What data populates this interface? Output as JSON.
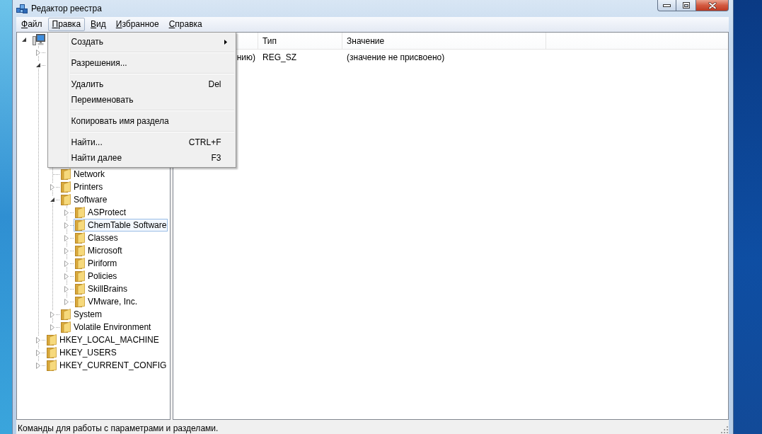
{
  "window": {
    "title": "Редактор реестра",
    "caption_buttons": [
      {
        "kind": "minimize"
      },
      {
        "kind": "maximize"
      },
      {
        "kind": "close"
      }
    ]
  },
  "menu_bar": {
    "items": [
      {
        "label": "Файл",
        "selected": false
      },
      {
        "label": "Правка",
        "selected": true
      },
      {
        "label": "Вид",
        "selected": false
      },
      {
        "label": "Избранное",
        "selected": false
      },
      {
        "label": "Справка",
        "selected": false
      }
    ]
  },
  "dropdown_menu": {
    "groups": [
      [
        {
          "label": "Создать",
          "submenu": true
        }
      ],
      [
        {
          "label": "Разрешения...",
          "submenu": false
        }
      ],
      [
        {
          "label": "Удалить",
          "shortcut": "Del",
          "submenu": false
        },
        {
          "label": "Переименовать",
          "submenu": false
        }
      ],
      [
        {
          "label": "Копировать имя раздела",
          "submenu": false
        }
      ],
      [
        {
          "label": "Найти...",
          "shortcut": "CTRL+F",
          "submenu": false
        },
        {
          "label": "Найти далее",
          "shortcut": "F3",
          "submenu": false
        }
      ]
    ]
  },
  "tree": {
    "items": [
      {
        "expanded": true,
        "selected": false,
        "children": [
          {
            "expanded": false
          },
          {
            "expanded": true,
            "children": [
              {
                "label": "Network",
                "selected": false
              },
              {
                "label": "Printers",
                "expanded": false,
                "selected": false
              },
              {
                "label": "Software",
                "expanded": true,
                "selected": false,
                "children": [
                  {
                    "label": "ASProtect",
                    "expanded": false,
                    "selected": false
                  },
                  {
                    "label": "ChemTable Software",
                    "expanded": false,
                    "selected": true
                  },
                  {
                    "label": "Classes",
                    "expanded": false,
                    "selected": false
                  },
                  {
                    "label": "Microsoft",
                    "expanded": false,
                    "selected": false
                  },
                  {
                    "label": "Piriform",
                    "expanded": false,
                    "selected": false
                  },
                  {
                    "label": "Policies",
                    "expanded": false,
                    "selected": false
                  },
                  {
                    "label": "SkillBrains",
                    "expanded": false,
                    "selected": false
                  },
                  {
                    "label": "VMware, Inc.",
                    "expanded": false,
                    "selected": false
                  }
                ]
              },
              {
                "label": "System",
                "expanded": false,
                "selected": false
              },
              {
                "label": "Volatile Environment",
                "expanded": false,
                "selected": false
              }
            ]
          },
          {
            "label": "HKEY_LOCAL_MACHINE",
            "expanded": false,
            "selected": false
          },
          {
            "label": "HKEY_USERS",
            "expanded": false,
            "selected": false
          },
          {
            "label": "HKEY_CURRENT_CONFIG",
            "expanded": false,
            "selected": false
          }
        ]
      }
    ]
  },
  "list": {
    "columns": [
      "",
      "Тип",
      "Значение"
    ],
    "rows": [
      {
        "cells": [
          "нию)",
          "REG_SZ",
          "(значение не присвоено)"
        ]
      }
    ]
  },
  "status_bar": {
    "text": "Команды для работы с параметрами и разделами."
  }
}
